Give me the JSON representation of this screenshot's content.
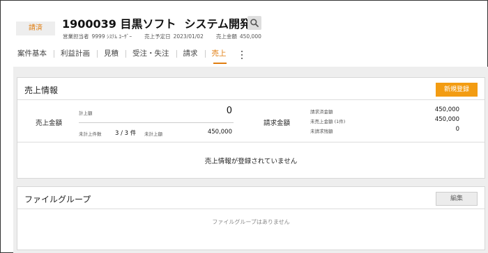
{
  "header": {
    "status": "請済",
    "title_id": "1900039",
    "title_customer": "目黒ソフト",
    "title_project": "システム開発",
    "meta": {
      "rep_label": "営業担当者",
      "rep_value": "9999 ｼｽﾃﾑ ﾕｰｻﾞｰ",
      "date_label": "売上予定日",
      "date_value": "2023/01/02",
      "amount_label": "売上金額",
      "amount_value": "450,000"
    }
  },
  "tabs": [
    {
      "label": "案件基本"
    },
    {
      "label": "利益計画"
    },
    {
      "label": "見積"
    },
    {
      "label": "受注・失注"
    },
    {
      "label": "請求"
    },
    {
      "label": "売上"
    }
  ],
  "sales": {
    "title": "売上情報",
    "register_label": "新規登録",
    "amount_label": "売上金額",
    "recorded_label": "計上額",
    "recorded_value": "0",
    "unrecorded_count_label": "未計上件数",
    "unrecorded_count_value": "3 / 3 件",
    "unrecorded_amount_label": "未計上額",
    "unrecorded_amount_value": "450,000",
    "billing_label": "請求金額",
    "billed_label": "請求済金額",
    "billed_value": "450,000",
    "unsold_label": "未売上金額 (1件)",
    "unsold_value": "450,000",
    "unbilled_label": "未請求残額",
    "unbilled_value": "0",
    "empty_message": "売上情報が登録されていません"
  },
  "files": {
    "title": "ファイルグループ",
    "edit_label": "編集",
    "empty_message": "ファイルグループはありません"
  },
  "colors": {
    "accent": "#f39c12",
    "active_tab": "#e07d10"
  }
}
